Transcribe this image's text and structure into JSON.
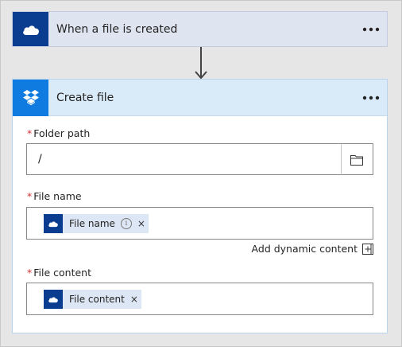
{
  "trigger": {
    "title": "When a file is created",
    "icon": "onedrive-cloud-icon",
    "menu_icon": "ellipsis-icon"
  },
  "action": {
    "title": "Create file",
    "icon": "dropbox-icon",
    "menu_icon": "ellipsis-icon",
    "fields": {
      "folder_path": {
        "required_marker": "*",
        "label": "Folder path",
        "value": "/",
        "picker_icon": "folder-icon"
      },
      "file_name": {
        "required_marker": "*",
        "label": "File name",
        "token_label": "File name",
        "token_info": "i",
        "token_remove": "×"
      },
      "file_content": {
        "required_marker": "*",
        "label": "File content",
        "token_label": "File content",
        "token_remove": "×"
      }
    },
    "dynamic_content_label": "Add dynamic content"
  },
  "colors": {
    "onedrive_blue": "#0a3d8f",
    "dropbox_blue": "#0f7ae0",
    "required_red": "#d13438"
  }
}
